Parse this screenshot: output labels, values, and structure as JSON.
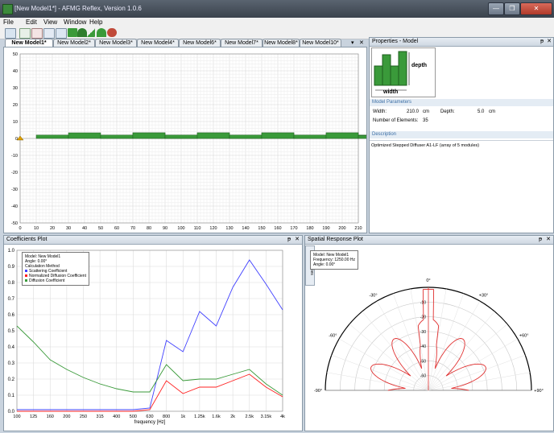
{
  "window": {
    "title": "[New Model1*] - AFMG Reflex, Version 1.0.6",
    "min_glyph": "—",
    "max_glyph": "❐",
    "close_glyph": "✕"
  },
  "menu": {
    "items": [
      "File",
      "Edit",
      "View",
      "Window",
      "Help"
    ]
  },
  "tabs": {
    "items": [
      "New Model1*",
      "New Model2*",
      "New Model3*",
      "New Model4*",
      "New Model6*",
      "New Model7*",
      "New Model8*",
      "New Model10*"
    ],
    "pin_glyph": "▾",
    "close_glyph": "✕"
  },
  "model_view": {
    "y_ticks": [
      "50",
      "40",
      "30",
      "20",
      "10",
      "0",
      "-10",
      "-20",
      "-30",
      "-40",
      "-50"
    ],
    "x_ticks": [
      "0",
      "10",
      "20",
      "30",
      "40",
      "50",
      "60",
      "70",
      "80",
      "90",
      "100",
      "110",
      "120",
      "130",
      "140",
      "150",
      "160",
      "170",
      "180",
      "190",
      "200",
      "210"
    ],
    "module_heights": [
      0.6,
      1,
      0.5,
      1,
      0.6
    ]
  },
  "properties": {
    "header": "Properties - Model",
    "pin_glyph": "ᵽ",
    "close_glyph": "✕",
    "diagram_depth": "depth",
    "diagram_width": "width",
    "params_header": "Model Parameters",
    "width_label": "Width:",
    "width_value": "210.0",
    "width_unit": "cm",
    "depth_label": "Depth:",
    "depth_value": "5.0",
    "depth_unit": "cm",
    "elements_label": "Number of Elements:",
    "elements_value": "35",
    "desc_header": "Description",
    "description": "Optimized Stepped Diffuser A1-LF (array of 5 modules)"
  },
  "coeff_plot": {
    "header": "Coefficients Plot",
    "pin_glyph": "ᵽ",
    "close_glyph": "✕",
    "legend": {
      "model_label": "Model:",
      "model": "New Model1",
      "angle_label": "Angle:",
      "angle": "0.00°",
      "calc": "Calculation Method",
      "s1": "Scattering Coefficient",
      "s2": "Normalized Diffusion Coefficient",
      "s3": "Diffusion Coefficient"
    },
    "xlabel": "frequency [Hz]"
  },
  "spatial": {
    "header": "Spatial Response Plot",
    "pin_glyph": "ᵽ",
    "close_glyph": "✕",
    "side_tab": "Properties",
    "legend": {
      "model_label": "Model:",
      "model": "New Model1",
      "freq_label": "Frequency:",
      "freq": "1250.00 Hz",
      "angle_label": "Angle:",
      "angle": "0.00°"
    },
    "angle_labels": [
      "-90°",
      "-60°",
      "-30°",
      "0°",
      "+30°",
      "+60°",
      "+90°"
    ],
    "radial_labels": [
      "-10",
      "-20",
      "-30",
      "-40",
      "-50",
      "-60"
    ]
  },
  "chart_data": {
    "type": "line",
    "x": [
      "100",
      "125",
      "160",
      "200",
      "250",
      "315",
      "400",
      "500",
      "630",
      "800",
      "1k",
      "1.25k",
      "1.6k",
      "2k",
      "2.5k",
      "3.15k",
      "4k"
    ],
    "ylim": [
      0,
      1
    ],
    "yticks": [
      "0.0",
      "0.1",
      "0.2",
      "0.3",
      "0.4",
      "0.5",
      "0.6",
      "0.7",
      "0.8",
      "0.9",
      "1.0"
    ],
    "xlabel": "frequency [Hz]",
    "series": [
      {
        "name": "Scattering Coefficient",
        "color": "#4040ff",
        "values": [
          0.01,
          0.01,
          0.01,
          0.01,
          0.01,
          0.01,
          0.01,
          0.01,
          0.02,
          0.44,
          0.37,
          0.62,
          0.53,
          0.77,
          0.94,
          0.79,
          0.63
        ]
      },
      {
        "name": "Normalized Diffusion Coefficient",
        "color": "#ff2020",
        "values": [
          0.0,
          0.0,
          0.0,
          0.0,
          0.0,
          0.0,
          0.0,
          0.0,
          0.01,
          0.19,
          0.11,
          0.15,
          0.15,
          0.19,
          0.23,
          0.15,
          0.09
        ]
      },
      {
        "name": "Diffusion Coefficient",
        "color": "#3a9a3a",
        "values": [
          0.53,
          0.43,
          0.32,
          0.26,
          0.21,
          0.17,
          0.14,
          0.12,
          0.12,
          0.29,
          0.19,
          0.2,
          0.2,
          0.23,
          0.26,
          0.17,
          0.1
        ]
      }
    ]
  },
  "colors": {
    "accent": "#3a9a3a",
    "element": "#3a9a3a"
  }
}
